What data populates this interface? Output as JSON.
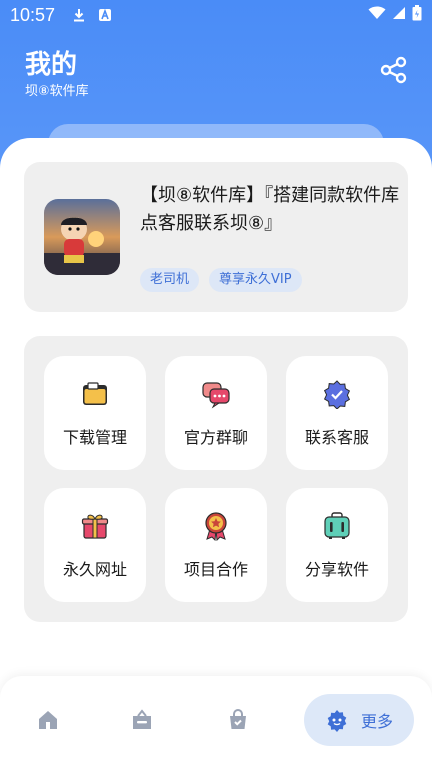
{
  "status_bar": {
    "time": "10:57"
  },
  "header": {
    "title": "我的",
    "subtitle": "坝⑧软件库"
  },
  "profile": {
    "name": "【坝⑧软件库】『搭建同款软件库点客服联系坝⑧』",
    "tags": [
      "老司机",
      "尊享永久VIP"
    ]
  },
  "grid": {
    "items": [
      {
        "label": "下载管理",
        "icon": "folder-icon"
      },
      {
        "label": "官方群聊",
        "icon": "chat-bubbles-icon"
      },
      {
        "label": "联系客服",
        "icon": "verified-badge-icon"
      },
      {
        "label": "永久网址",
        "icon": "gift-icon"
      },
      {
        "label": "项目合作",
        "icon": "medal-icon"
      },
      {
        "label": "分享软件",
        "icon": "suitcase-icon"
      }
    ]
  },
  "bottom_nav": {
    "items": [
      {
        "icon": "home-icon",
        "label": ""
      },
      {
        "icon": "store-icon",
        "label": ""
      },
      {
        "icon": "bag-icon",
        "label": ""
      },
      {
        "icon": "more-icon",
        "label": "更多",
        "active": true
      }
    ]
  },
  "colors": {
    "header_blue": "#4a8cf7",
    "accent": "#3e6fd6",
    "card_bg": "#efefef",
    "tag_bg": "#dde7f7"
  }
}
